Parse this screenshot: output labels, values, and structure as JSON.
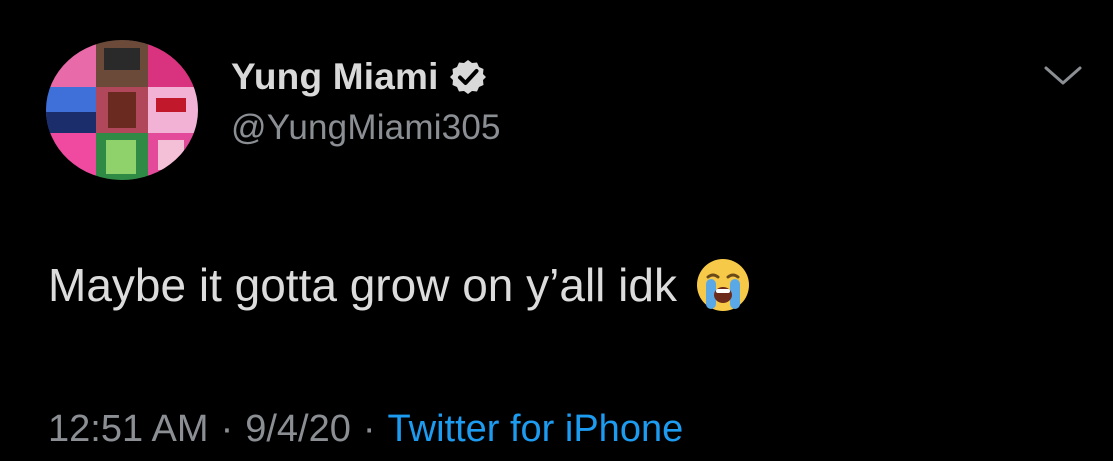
{
  "user": {
    "display_name": "Yung Miami",
    "handle": "@YungMiami305",
    "verified": true,
    "avatar_icon": "profile-collage"
  },
  "tweet": {
    "text": "Maybe it gotta grow on y’all idk",
    "emoji": "😭"
  },
  "meta": {
    "time": "12:51 AM",
    "date": "9/4/20",
    "separator": "·",
    "source": "Twitter for iPhone"
  },
  "colors": {
    "background": "#000000",
    "primary_text": "#d9d9d9",
    "secondary_text": "#8b8f94",
    "link": "#1d9bf0",
    "verified_badge": "#d9d9d9"
  },
  "icons": {
    "verified": "verified-badge-icon",
    "menu": "chevron-down-icon",
    "emoji": "loudly-crying-face-icon"
  }
}
